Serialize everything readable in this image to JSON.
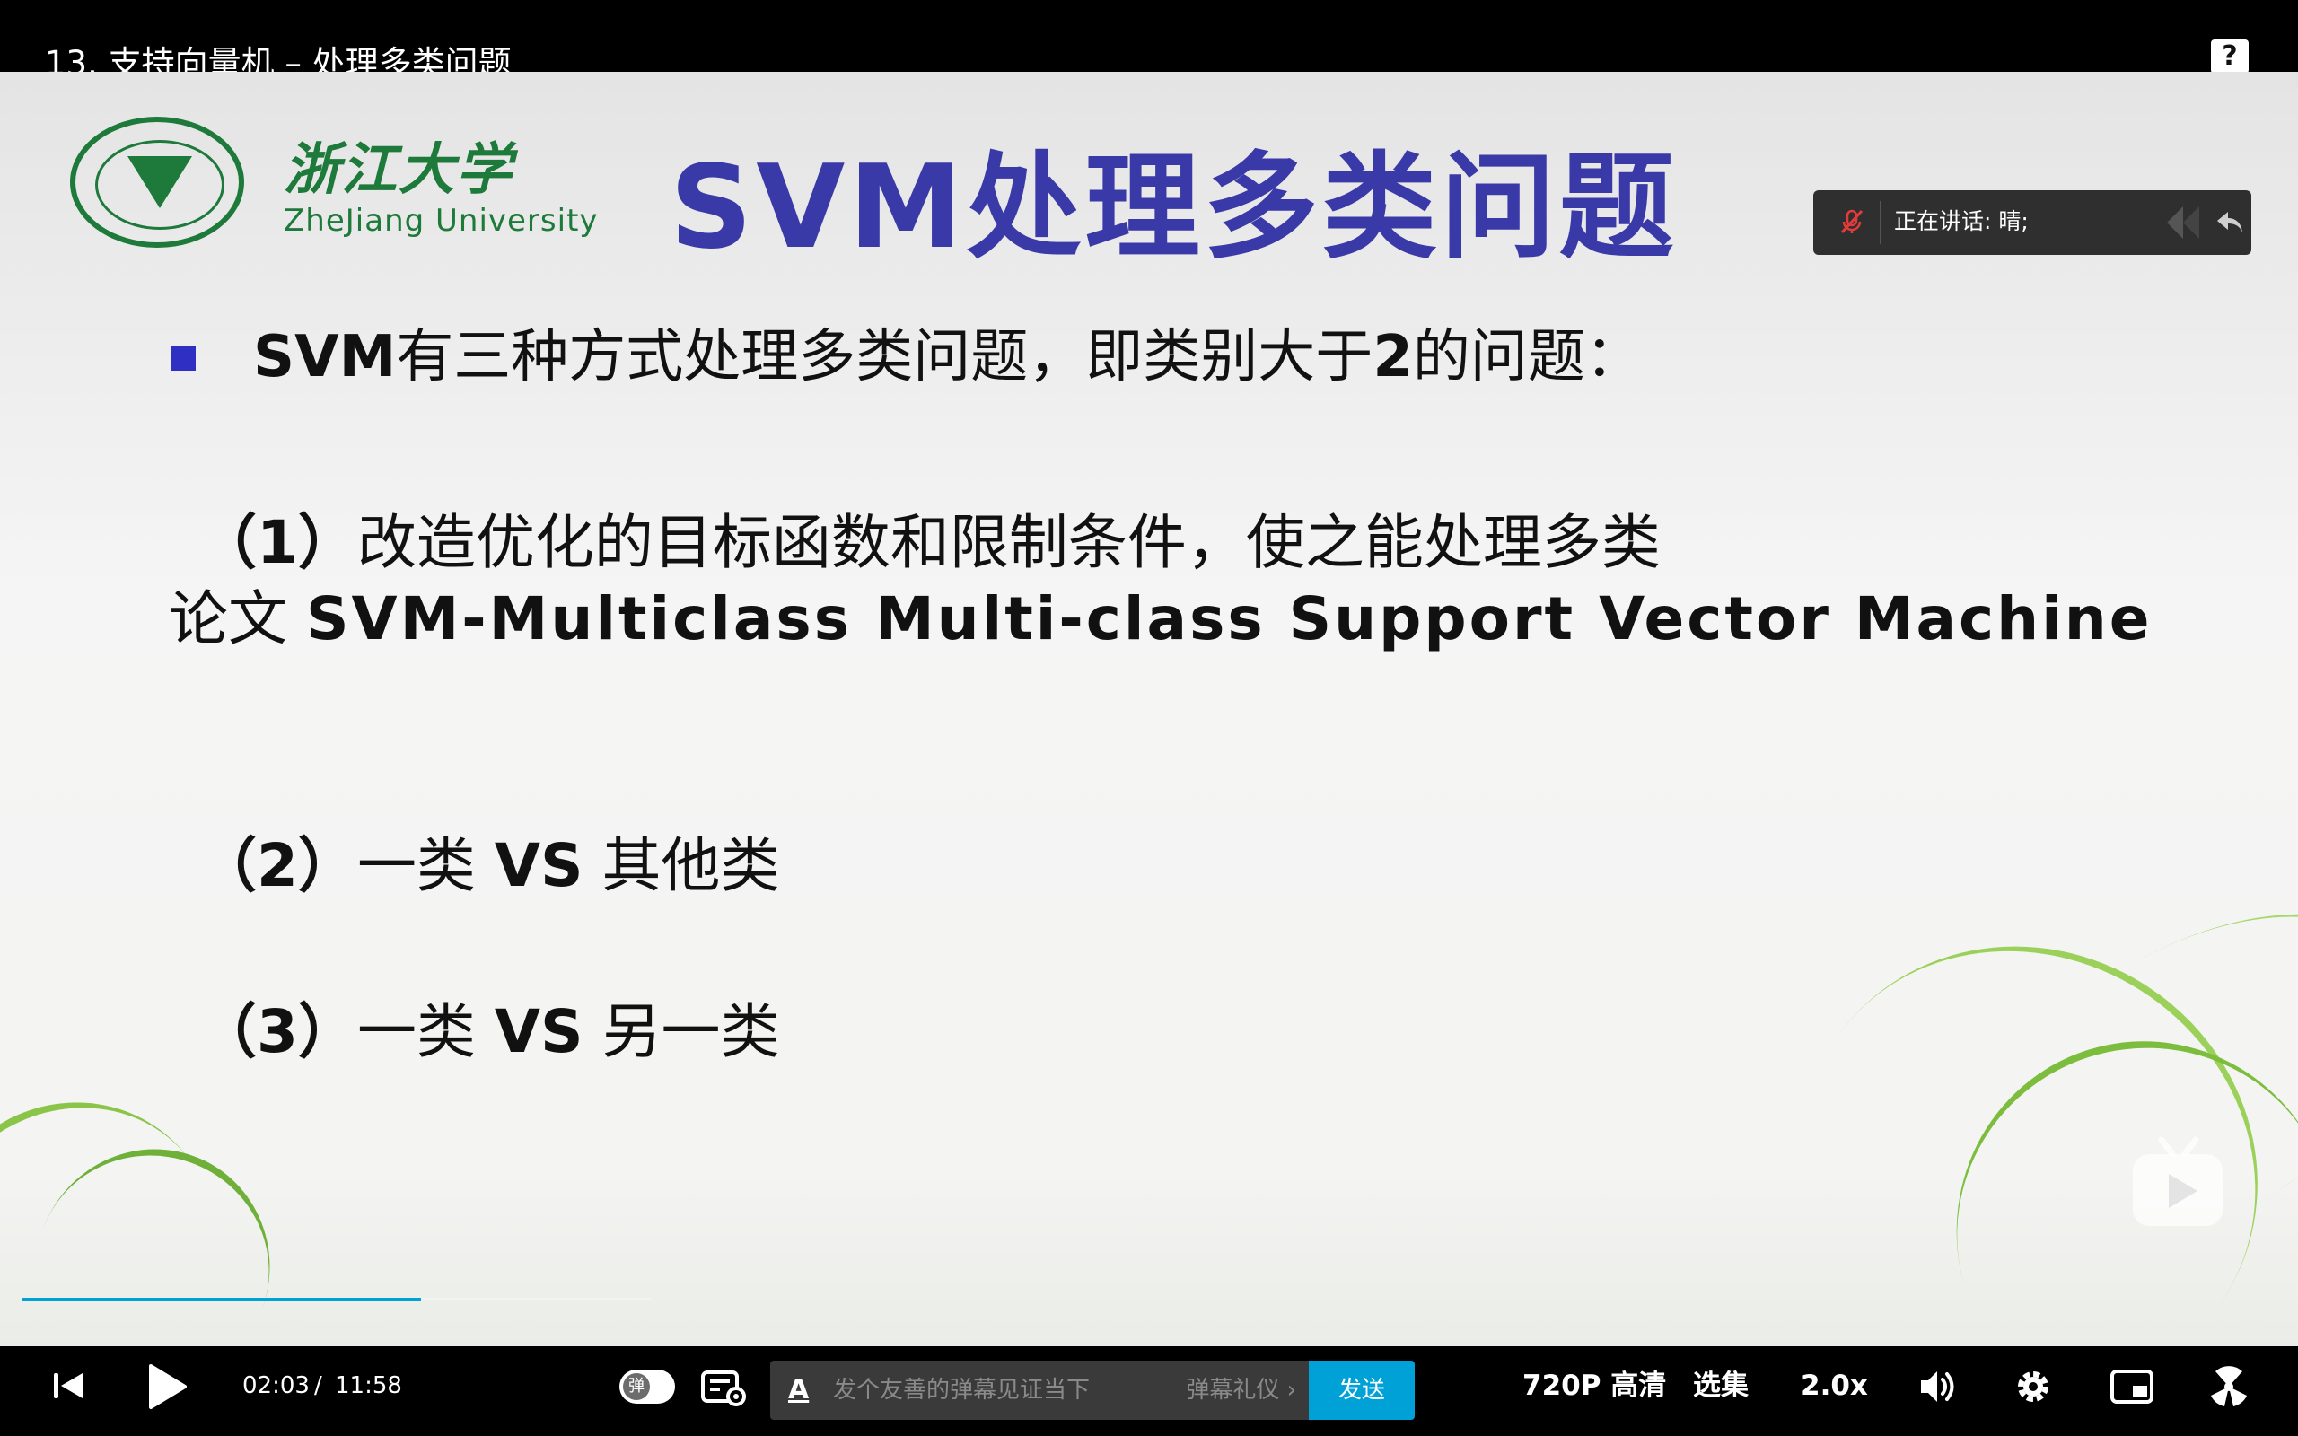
{
  "header": {
    "title": "13. 支持向量机 – 处理多类问题",
    "help_label": "?"
  },
  "slide": {
    "logo_cn": "浙江大学",
    "logo_en": "ZheJiang University",
    "title": "SVM处理多类问题",
    "bullet": {
      "bold1": "SVM",
      "text1": "有三种方式处理多类问题，即类别大于",
      "bold2": "2",
      "text2": "的问题："
    },
    "item1": {
      "num": "（1）",
      "text": "改造优化的目标函数和限制条件，使之能处理多类"
    },
    "paper": {
      "prefix": "论文 ",
      "title": "SVM-Multiclass Multi-class Support Vector Machine"
    },
    "item2": {
      "num": "（2）",
      "pre": "一类 ",
      "vs": "VS",
      "post": " 其他类"
    },
    "item3": {
      "num": "（3）",
      "pre": "一类 ",
      "vs": "VS",
      "post": " 另一类"
    }
  },
  "speaking": {
    "text": "正在讲话: 晴;"
  },
  "player": {
    "progress_fraction": 0.177,
    "time_current": "02:03",
    "time_separator": "/",
    "time_total": "11:58",
    "danmaku_toggle_label": "弹",
    "danmaku_placeholder": "发个友善的弹幕见证当下",
    "etiquette_label": "弹幕礼仪 ›",
    "send_label": "发送",
    "quality_label": "720P 高清",
    "episodes_label": "选集",
    "speed_label": "2.0x"
  },
  "colors": {
    "accent": "#00a1d6",
    "slide_title": "#3a39a8",
    "logo_green": "#1e7a3a"
  }
}
